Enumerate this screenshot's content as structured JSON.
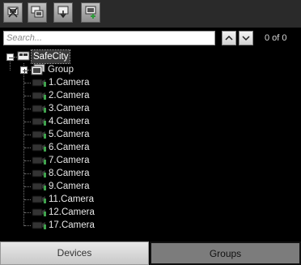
{
  "toolbar": {
    "buttons": [
      {
        "icon": "remove-device-icon"
      },
      {
        "icon": "copy-windows-icon"
      },
      {
        "icon": "move-down-icon"
      },
      {
        "icon": "add-group-icon"
      }
    ]
  },
  "search": {
    "placeholder": "Search...",
    "value": "",
    "counter": "0 of 0"
  },
  "tree": {
    "root": {
      "label": "SafeCity",
      "icon": "server-icon",
      "expanded": true
    },
    "group": {
      "label": "Group",
      "icon": "group-icon",
      "expanded": false
    },
    "cameras": [
      "1.Camera",
      "2.Camera",
      "3.Camera",
      "4.Camera",
      "5.Camera",
      "6.Camera",
      "7.Camera",
      "8.Camera",
      "9.Camera",
      "11.Camera",
      "12.Camera",
      "17.Camera"
    ]
  },
  "tabs": {
    "devices": "Devices",
    "groups": "Groups",
    "active": "groups"
  },
  "colors": {
    "background": "#000000",
    "camera_green": "#3fa34d",
    "active_tab": "#7c7c7c"
  }
}
